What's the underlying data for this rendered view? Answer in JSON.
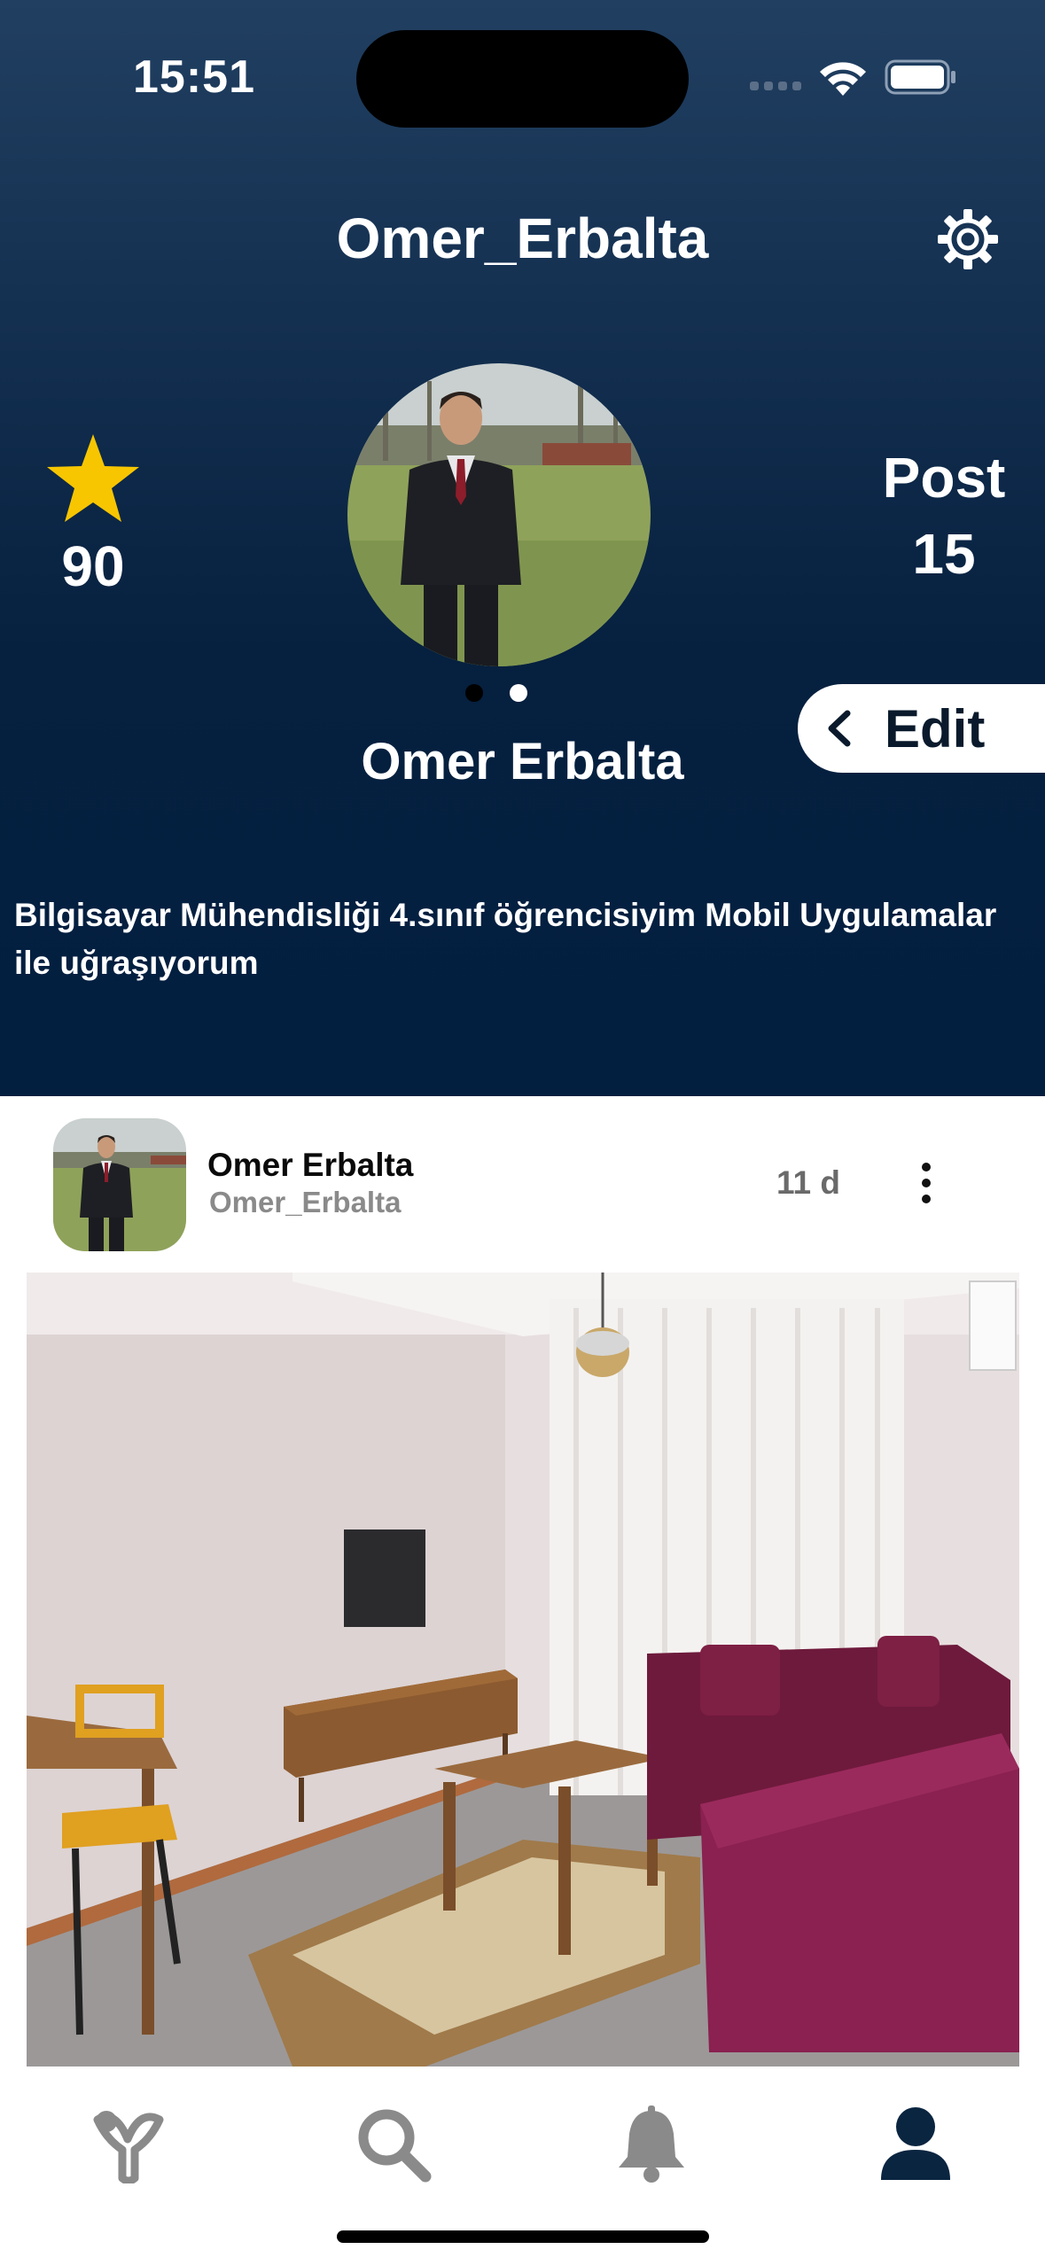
{
  "status_bar": {
    "time": "15:51",
    "icons": [
      "cellular-signal-icon",
      "wifi-icon",
      "battery-icon"
    ]
  },
  "profile": {
    "username": "Omer_Erbalta",
    "display_name": "Omer Erbalta",
    "star_count": "90",
    "post_label": "Post",
    "post_count": "15",
    "edit_label": "Edit",
    "bio": "Bilgisayar Mühendisliği 4.sınıf öğrencisiyim Mobil Uygulamalar ile uğraşıyorum",
    "avatar_pages": 2,
    "avatar_active_page": 2
  },
  "post": {
    "author_name": "Omer Erbalta",
    "author_handle": "Omer_Erbalta",
    "time_ago": "11 d"
  },
  "tabbar": {
    "tabs": [
      {
        "icon": "home-logo-icon",
        "active": false
      },
      {
        "icon": "search-icon",
        "active": false
      },
      {
        "icon": "bell-icon",
        "active": false
      },
      {
        "icon": "profile-icon",
        "active": true
      }
    ]
  },
  "colors": {
    "header_top": "#213f61",
    "header_bottom": "#021f40",
    "star": "#f7c600",
    "tab_inactive": "#8a8a8a",
    "tab_active": "#0a2540"
  }
}
